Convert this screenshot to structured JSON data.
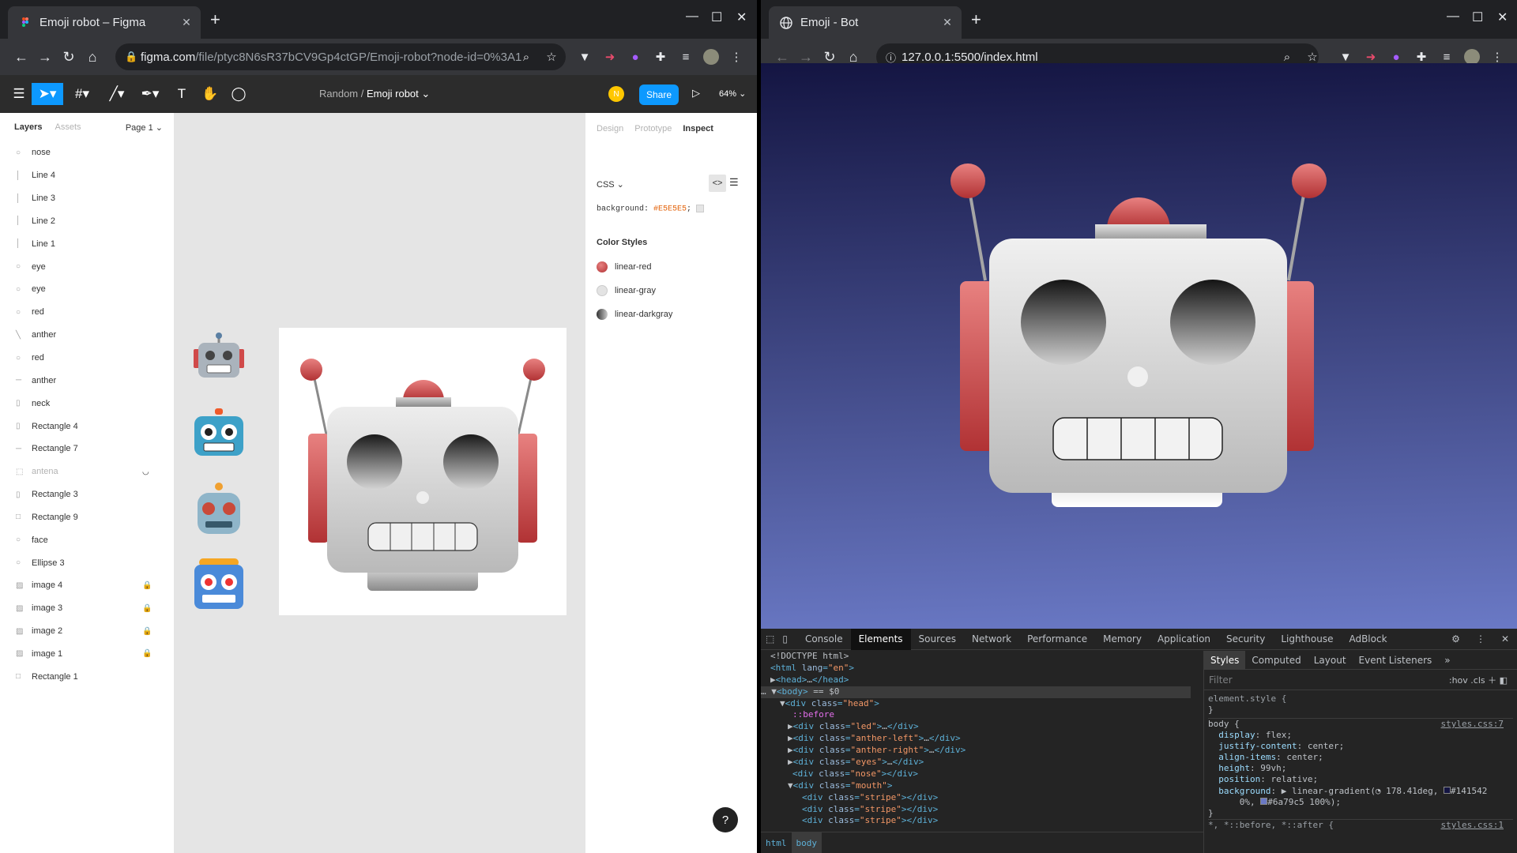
{
  "left": {
    "tab_title": "Emoji robot – Figma",
    "url_host": "figma.com",
    "url_path": "/file/ptyc8N6sR37bCV9Gp4ctGP/Emoji-robot?node-id=0%3A1",
    "figma": {
      "breadcrumb_project": "Random",
      "breadcrumb_sep": "/",
      "file_name": "Emoji robot",
      "avatar_letter": "N",
      "share_label": "Share",
      "zoom": "64%",
      "layers_tab": "Layers",
      "assets_tab": "Assets",
      "page_label": "Page 1",
      "layers": [
        {
          "name": "nose",
          "icon": "○",
          "locked": false,
          "hidden": false
        },
        {
          "name": "Line 4",
          "icon": "│",
          "locked": false,
          "hidden": false
        },
        {
          "name": "Line 3",
          "icon": "│",
          "locked": false,
          "hidden": false
        },
        {
          "name": "Line 2",
          "icon": "│",
          "locked": false,
          "hidden": false
        },
        {
          "name": "Line 1",
          "icon": "│",
          "locked": false,
          "hidden": false
        },
        {
          "name": "eye",
          "icon": "○",
          "locked": false,
          "hidden": false
        },
        {
          "name": "eye",
          "icon": "○",
          "locked": false,
          "hidden": false
        },
        {
          "name": "red",
          "icon": "○",
          "locked": false,
          "hidden": false
        },
        {
          "name": "anther",
          "icon": "╲",
          "locked": false,
          "hidden": false
        },
        {
          "name": "red",
          "icon": "○",
          "locked": false,
          "hidden": false
        },
        {
          "name": "anther",
          "icon": "─",
          "locked": false,
          "hidden": false
        },
        {
          "name": "neck",
          "icon": "▯",
          "locked": false,
          "hidden": false
        },
        {
          "name": "Rectangle 4",
          "icon": "▯",
          "locked": false,
          "hidden": false
        },
        {
          "name": "Rectangle 7",
          "icon": "─",
          "locked": false,
          "hidden": false
        },
        {
          "name": "antena",
          "icon": "⬚",
          "locked": false,
          "hidden": true
        },
        {
          "name": "Rectangle 3",
          "icon": "▯",
          "locked": false,
          "hidden": false
        },
        {
          "name": "Rectangle 9",
          "icon": "□",
          "locked": false,
          "hidden": false
        },
        {
          "name": "face",
          "icon": "○",
          "locked": false,
          "hidden": false
        },
        {
          "name": "Ellipse 3",
          "icon": "○",
          "locked": false,
          "hidden": false
        },
        {
          "name": "image 4",
          "icon": "▨",
          "locked": true,
          "hidden": false
        },
        {
          "name": "image 3",
          "icon": "▨",
          "locked": true,
          "hidden": false
        },
        {
          "name": "image 2",
          "icon": "▨",
          "locked": true,
          "hidden": false
        },
        {
          "name": "image 1",
          "icon": "▨",
          "locked": true,
          "hidden": false
        },
        {
          "name": "Rectangle 1",
          "icon": "□",
          "locked": false,
          "hidden": false
        }
      ],
      "right_tabs": [
        "Design",
        "Prototype",
        "Inspect"
      ],
      "code_lang": "CSS",
      "bg_prop": "background:",
      "bg_value": "#E5E5E5",
      "bg_end": ";",
      "color_styles_heading": "Color Styles",
      "color_styles": [
        {
          "name": "linear-red",
          "color": "#c9474d"
        },
        {
          "name": "linear-gray",
          "color": "#e3e3e3"
        },
        {
          "name": "linear-darkgray",
          "color": "#7a7a7a"
        }
      ],
      "help_label": "?"
    }
  },
  "right": {
    "tab_title": "Emoji - Bot",
    "url": "127.0.0.1:5500/index.html",
    "devtools": {
      "tabs": [
        "Console",
        "Elements",
        "Sources",
        "Network",
        "Performance",
        "Memory",
        "Application",
        "Security",
        "Lighthouse",
        "AdBlock"
      ],
      "styles_tabs": [
        "Styles",
        "Computed",
        "Layout",
        "Event Listeners"
      ],
      "filter_placeholder": "Filter",
      "hov_cls": ":hov  .cls",
      "breadcrumb": [
        "html",
        "body"
      ],
      "style_link": "styles.css:7",
      "style_link2": "styles.css:1",
      "gradient_start": "#141542",
      "gradient_end": "#6a79c5"
    }
  }
}
